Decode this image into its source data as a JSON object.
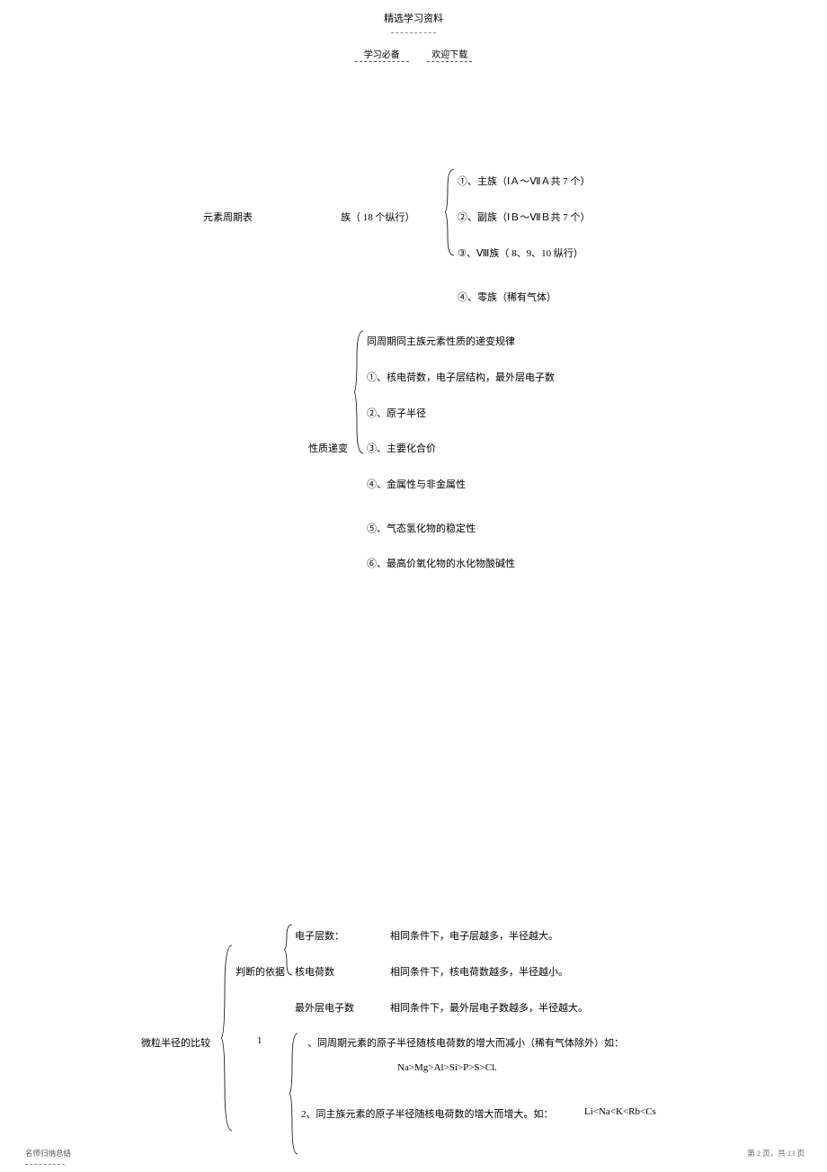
{
  "header": {
    "title": "精选学习资料",
    "left_text": "学习必备",
    "right_text": "欢迎下载"
  },
  "section1": {
    "label_periodic_table": "元素周期表",
    "label_family": "族（ 18 个纵行）",
    "item1": "①、主族（ⅠＡ～ⅦＡ共 7 个）",
    "item2": "②、副族（ⅠＢ～ⅦＢ共 7 个）",
    "item3": "③、Ⅷ族（ 8、9、10 纵行）",
    "item4": "④、零族（稀有气体）"
  },
  "section2": {
    "label_property": "性质递变",
    "title": "同周期同主族元素性质的递变规律",
    "item1": "①、核电荷数，电子层结构，最外层电子数",
    "item2": "②、原子半径",
    "item3": "③、主要化合价",
    "item4": "④、金属性与非金属性",
    "item5": "⑤、气态氢化物的稳定性",
    "item6": "⑥、最高价氧化物的水化物酸碱性"
  },
  "section3": {
    "label_compare": "微粒半径的比较",
    "label_basis": "判断的依据",
    "basis1_label": "电子层数：",
    "basis1_text": "相同条件下，电子层越多，半径越大。",
    "basis2_label": "核电荷数",
    "basis2_text": "相同条件下，核电荷数越多，半径越小。",
    "basis3_label": "最外层电子数",
    "basis3_text": "相同条件下，最外层电子数越多，半径越大。",
    "label_1": "1",
    "rule1_text": "、同周期元素的原子半径随核电荷数的增大而减小（稀有气体除外）如：",
    "rule1_example": "Na>Mg>Al>Si>P>S>Cl.",
    "rule2_text": "2、同主族元素的原子半径随核电荷数的增大而增大。如：",
    "rule2_example": "Li<Na<K<Rb<Cs"
  },
  "footer": {
    "left": "名师归纳总结",
    "right": "第 2 页，共 13 页"
  }
}
